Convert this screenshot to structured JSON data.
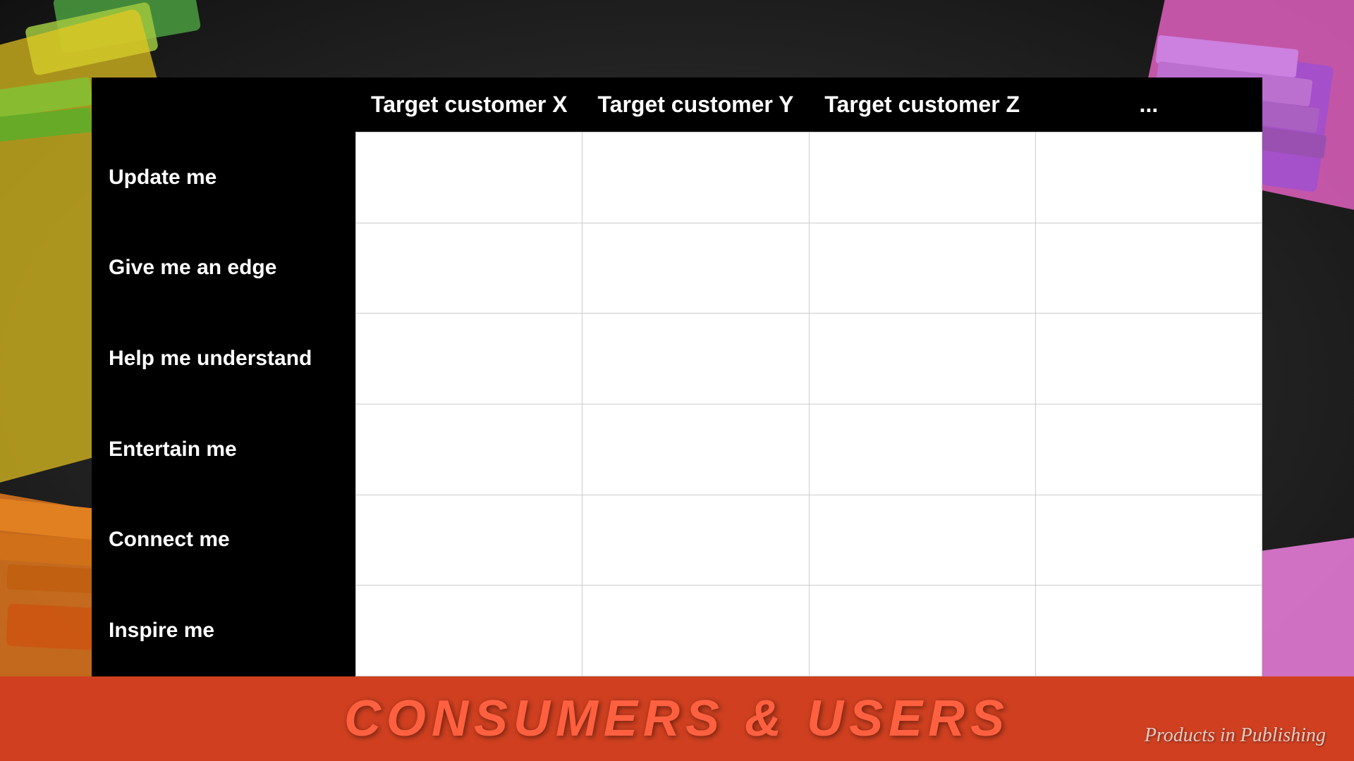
{
  "background": {
    "color": "#2a2a2a"
  },
  "bottom_banner": {
    "text": "Consumers & Users"
  },
  "watermark": {
    "text": "Products in Publishing"
  },
  "table": {
    "headers": {
      "empty": "",
      "col1": "Target customer X",
      "col2": "Target customer Y",
      "col3": "Target customer Z",
      "col4": "..."
    },
    "rows": [
      {
        "label": "Update me"
      },
      {
        "label": "Give me an edge"
      },
      {
        "label": "Help me understand"
      },
      {
        "label": "Entertain me"
      },
      {
        "label": "Connect me"
      },
      {
        "label": "Inspire me"
      }
    ]
  }
}
